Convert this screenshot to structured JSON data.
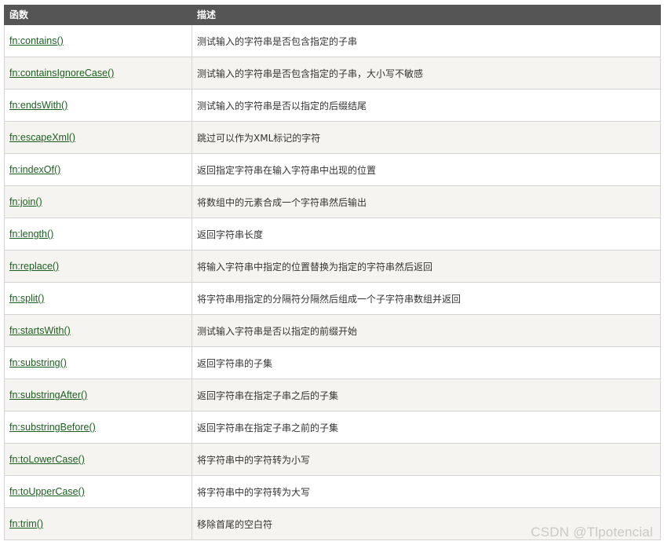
{
  "table": {
    "headers": [
      "函数",
      "描述"
    ],
    "rows": [
      {
        "fn": "fn:contains()",
        "desc": "测试输入的字符串是否包含指定的子串"
      },
      {
        "fn": "fn:containsIgnoreCase()",
        "desc": "测试输入的字符串是否包含指定的子串，大小写不敏感"
      },
      {
        "fn": "fn:endsWith()",
        "desc": "测试输入的字符串是否以指定的后缀结尾"
      },
      {
        "fn": "fn:escapeXml()",
        "desc": "跳过可以作为XML标记的字符"
      },
      {
        "fn": "fn:indexOf()",
        "desc": "返回指定字符串在输入字符串中出现的位置"
      },
      {
        "fn": "fn:join()",
        "desc": "将数组中的元素合成一个字符串然后输出"
      },
      {
        "fn": "fn:length()",
        "desc": "返回字符串长度"
      },
      {
        "fn": "fn:replace()",
        "desc": "将输入字符串中指定的位置替换为指定的字符串然后返回"
      },
      {
        "fn": "fn:split()",
        "desc": "将字符串用指定的分隔符分隔然后组成一个子字符串数组并返回"
      },
      {
        "fn": "fn:startsWith()",
        "desc": "测试输入字符串是否以指定的前缀开始"
      },
      {
        "fn": "fn:substring()",
        "desc": "返回字符串的子集"
      },
      {
        "fn": "fn:substringAfter()",
        "desc": "返回字符串在指定子串之后的子集"
      },
      {
        "fn": "fn:substringBefore()",
        "desc": "返回字符串在指定子串之前的子集"
      },
      {
        "fn": "fn:toLowerCase()",
        "desc": "将字符串中的字符转为小写"
      },
      {
        "fn": "fn:toUpperCase()",
        "desc": "将字符串中的字符转为大写"
      },
      {
        "fn": "fn:trim()",
        "desc": "移除首尾的空白符"
      }
    ]
  },
  "watermark": "CSDN @Tlpotencial",
  "colors": {
    "header_bg": "#555555",
    "header_text": "#ffffff",
    "link": "#1b5e20",
    "row_alt_bg": "#f6f4f0",
    "border": "#d4d4d4"
  }
}
